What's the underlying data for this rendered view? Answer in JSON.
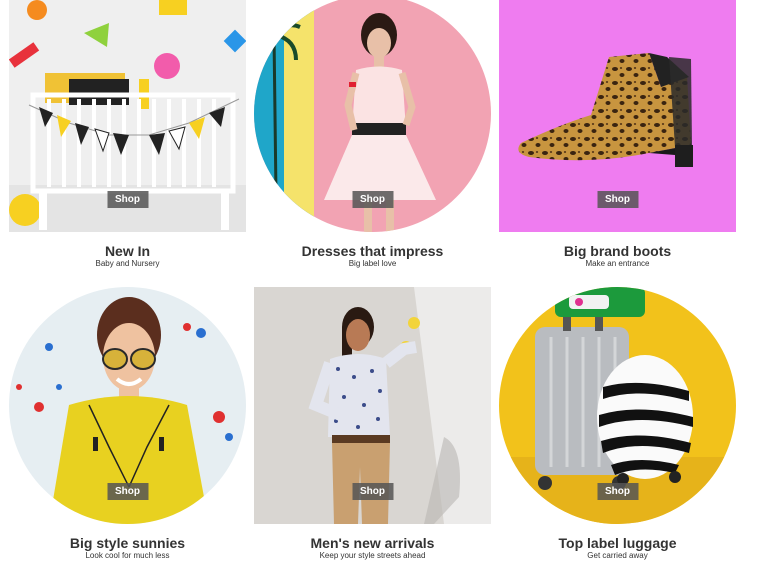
{
  "tiles": [
    {
      "title": "New In",
      "subtitle": "Baby and Nursery",
      "shop": "Shop"
    },
    {
      "title": "Dresses that impress",
      "subtitle": "Big label love",
      "shop": "Shop"
    },
    {
      "title": "Big brand boots",
      "subtitle": "Make an entrance",
      "shop": "Shop"
    },
    {
      "title": "Big style sunnies",
      "subtitle": "Look cool for much less",
      "shop": "Shop"
    },
    {
      "title": "Men's new arrivals",
      "subtitle": "Keep your style streets ahead",
      "shop": "Shop"
    },
    {
      "title": "Top label luggage",
      "subtitle": "Get carried away",
      "shop": "Shop"
    }
  ]
}
